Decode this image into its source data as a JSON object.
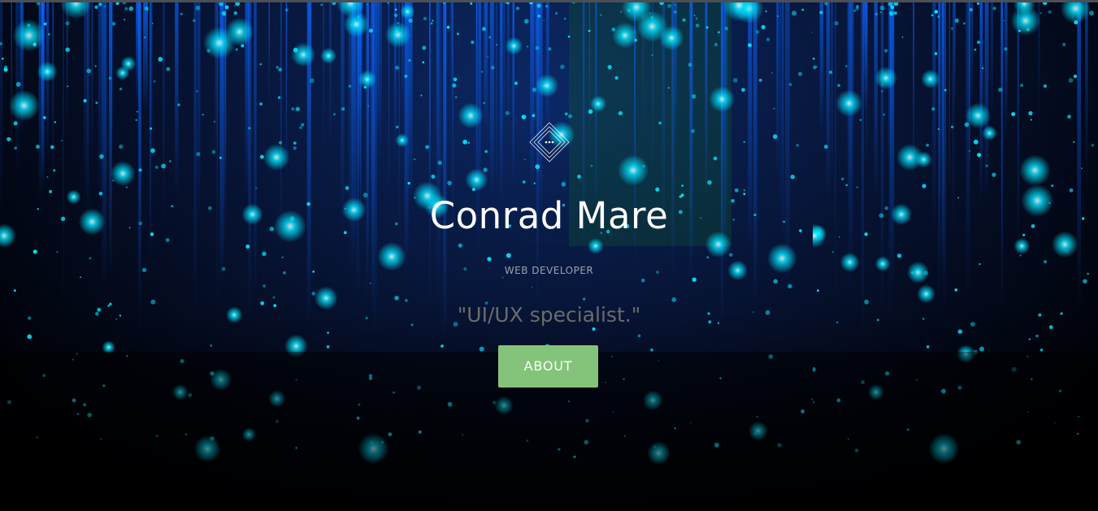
{
  "hero": {
    "name": "Conrad Mare",
    "role": "WEB DEVELOPER",
    "tagline": "\"UI/UX specialist.\"",
    "about_button_label": "ABOUT",
    "logo_icon": "diamond-logo-icon",
    "background": "blue-light-rain-image"
  },
  "colors": {
    "button": "#84c47a",
    "name": "#ffffff",
    "role": "#9aa3ad",
    "tagline": "#6b6b6b",
    "glow": "#00e5ff",
    "streak": "#0a64ff"
  }
}
